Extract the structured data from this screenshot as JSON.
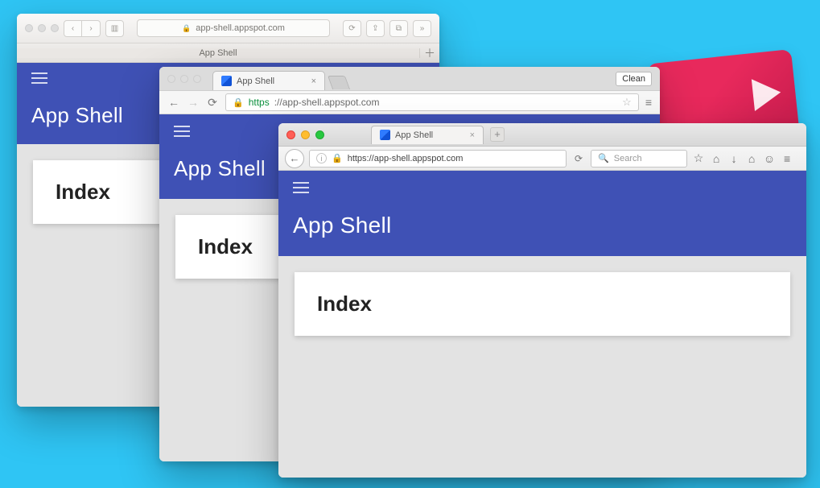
{
  "app": {
    "title": "App Shell",
    "card_heading": "Index"
  },
  "safari": {
    "url_display": "app-shell.appspot.com",
    "tab_title": "App Shell"
  },
  "chrome": {
    "tab_title": "App Shell",
    "url_scheme": "https",
    "url_host_path": "://app-shell.appspot.com",
    "clean_label": "Clean"
  },
  "firefox": {
    "tab_title": "App Shell",
    "url_text": "https://app-shell.appspot.com",
    "search_placeholder": "Search"
  }
}
